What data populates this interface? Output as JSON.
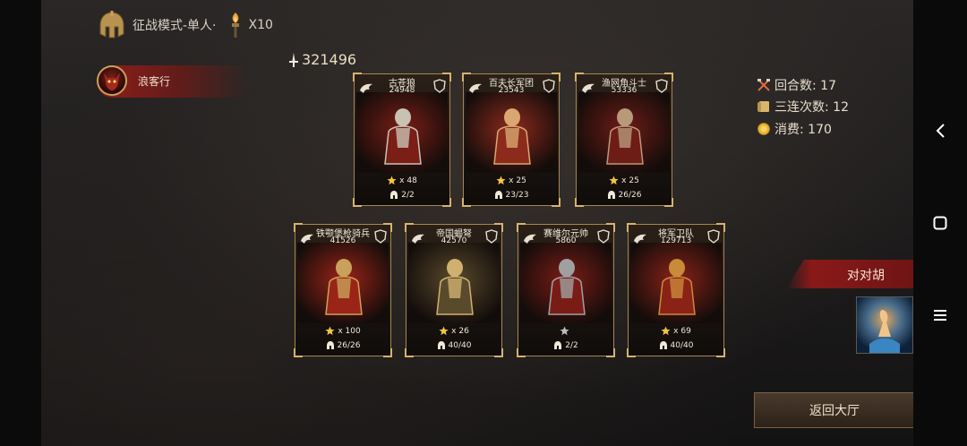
{
  "header": {
    "mode_label": "征战模式-单人·",
    "multiplier": "X10"
  },
  "player": {
    "name": "浪客行"
  },
  "power_total": "321496",
  "cards": [
    {
      "name": "古苍狼",
      "power": "24948",
      "stars": "x 48",
      "troops": "2/2",
      "right_icon": "wolf-crest-icon"
    },
    {
      "name": "百夫长军团",
      "power": "23543",
      "stars": "x 25",
      "troops": "23/23",
      "right_icon": "shield-crest-icon"
    },
    {
      "name": "渔网角斗士",
      "power": "53336",
      "stars": "x 25",
      "troops": "26/26",
      "right_icon": "shield-crest-icon"
    },
    {
      "name": "铁颚堡枪骑兵",
      "power": "41526",
      "stars": "x 100",
      "troops": "26/26",
      "right_icon": "horse-crest-icon"
    },
    {
      "name": "帝国蝎弩",
      "power": "42570",
      "stars": "x 26",
      "troops": "40/40",
      "right_icon": "crossbow-crest-icon"
    },
    {
      "name": "赛维尔元帅",
      "power": "5860",
      "stars": "",
      "troops": "2/2",
      "right_icon": "lion-crest-icon"
    },
    {
      "name": "将军卫队",
      "power": "129713",
      "stars": "x 69",
      "troops": "40/40",
      "right_icon": "horse-crest-icon"
    }
  ],
  "stats": {
    "rounds": "回合数: 17",
    "triple": "三连次数: 12",
    "cost": "消费: 170"
  },
  "opponent": {
    "name": "对对胡"
  },
  "buttons": {
    "back": "返回大厅"
  },
  "colors": {
    "accent_gold": "#a78652",
    "banner_red": "#962019"
  }
}
